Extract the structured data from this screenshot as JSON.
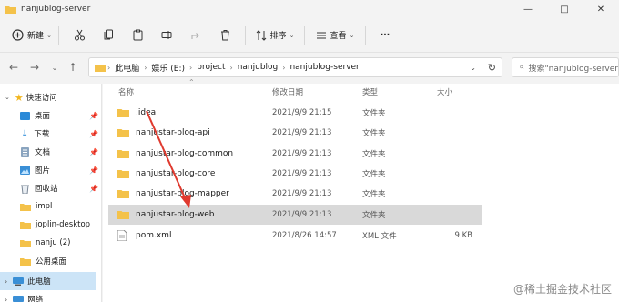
{
  "window": {
    "title": "nanjublog-server"
  },
  "toolbar": {
    "new_label": "新建",
    "sort_label": "排序",
    "view_label": "查看",
    "more_label": "···"
  },
  "address": {
    "crumbs": [
      "此电脑",
      "娱乐 (E:)",
      "project",
      "nanjublog",
      "nanjublog-server"
    ]
  },
  "search": {
    "placeholder": "搜索\"nanjublog-server"
  },
  "sidebar": {
    "items": [
      {
        "label": "快速访问",
        "icon": "star-icon"
      },
      {
        "label": "桌面",
        "icon": "desktop-icon"
      },
      {
        "label": "下载",
        "icon": "download-icon"
      },
      {
        "label": "文档",
        "icon": "document-icon"
      },
      {
        "label": "图片",
        "icon": "picture-icon"
      },
      {
        "label": "回收站",
        "icon": "recycle-bin-icon"
      },
      {
        "label": "impl",
        "icon": "folder-icon"
      },
      {
        "label": "joplin-desktop",
        "icon": "folder-icon"
      },
      {
        "label": "nanju (2)",
        "icon": "folder-icon"
      },
      {
        "label": "公用桌面",
        "icon": "folder-icon"
      },
      {
        "label": "此电脑",
        "icon": "computer-icon"
      },
      {
        "label": "网络",
        "icon": "network-icon"
      }
    ]
  },
  "columns": {
    "name": "名称",
    "modified": "修改日期",
    "type": "类型",
    "size": "大小"
  },
  "files": [
    {
      "name": ".idea",
      "modified": "2021/9/9 21:15",
      "type": "文件夹",
      "size": "",
      "kind": "folder"
    },
    {
      "name": "nanjustar-blog-api",
      "modified": "2021/9/9 21:13",
      "type": "文件夹",
      "size": "",
      "kind": "folder"
    },
    {
      "name": "nanjustar-blog-common",
      "modified": "2021/9/9 21:13",
      "type": "文件夹",
      "size": "",
      "kind": "folder"
    },
    {
      "name": "nanjustar-blog-core",
      "modified": "2021/9/9 21:13",
      "type": "文件夹",
      "size": "",
      "kind": "folder"
    },
    {
      "name": "nanjustar-blog-mapper",
      "modified": "2021/9/9 21:13",
      "type": "文件夹",
      "size": "",
      "kind": "folder"
    },
    {
      "name": "nanjustar-blog-web",
      "modified": "2021/9/9 21:13",
      "type": "文件夹",
      "size": "",
      "kind": "folder"
    },
    {
      "name": "pom.xml",
      "modified": "2021/8/26 14:57",
      "type": "XML 文件",
      "size": "9 KB",
      "kind": "file"
    }
  ],
  "watermark": "@稀土掘金技术社区",
  "colors": {
    "folder": "#f4c24a",
    "selection": "#d9d9d9",
    "sidebar_active": "#cce4f7",
    "arrow": "#e03a2f"
  }
}
